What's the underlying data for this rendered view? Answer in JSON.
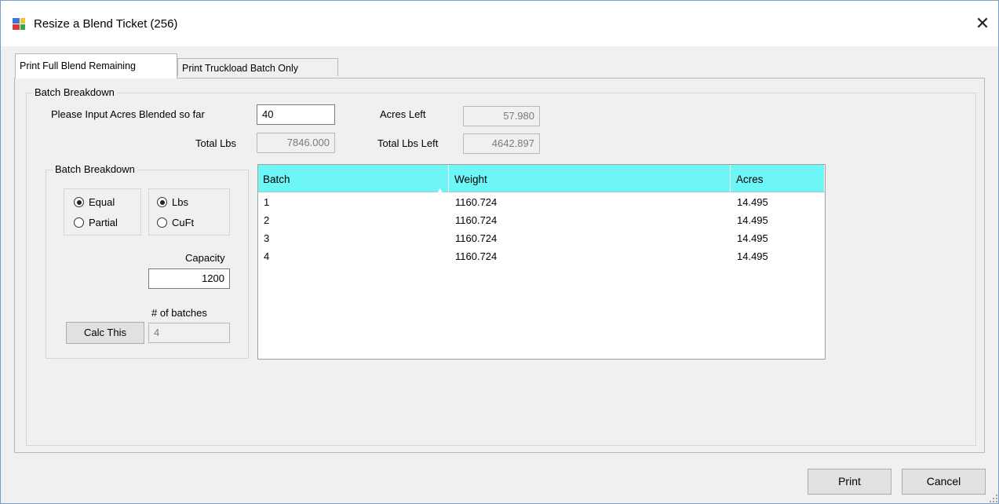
{
  "window": {
    "title": "Resize a Blend Ticket (256)",
    "close_glyph": "✕",
    "icon": "app-window-icon"
  },
  "tabs": [
    {
      "label": "Print Full Blend Remaining",
      "active": true
    },
    {
      "label": "Print Truckload Batch Only",
      "active": false
    }
  ],
  "batch_breakdown_group": {
    "label": "Batch Breakdown",
    "acres_blended_label": "Please Input Acres Blended so far",
    "acres_blended_value": "40",
    "total_lbs_label": "Total Lbs",
    "total_lbs_value": "7846.000",
    "acres_left_label": "Acres Left",
    "acres_left_value": "57.980",
    "total_lbs_left_label": "Total Lbs Left",
    "total_lbs_left_value": "4642.897"
  },
  "inner_group": {
    "label": "Batch Breakdown",
    "mode_options": [
      {
        "label": "Equal",
        "checked": true
      },
      {
        "label": "Partial",
        "checked": false
      }
    ],
    "unit_options": [
      {
        "label": "Lbs",
        "checked": true
      },
      {
        "label": "CuFt",
        "checked": false
      }
    ],
    "capacity_label": "Capacity",
    "capacity_value": "1200",
    "batches_label": "# of batches",
    "batches_value": "4",
    "calc_button": "Calc This"
  },
  "grid": {
    "header_color": "#6ef6f6",
    "columns": [
      "Batch",
      "Weight",
      "Acres"
    ],
    "rows": [
      [
        "1",
        "1160.724",
        "14.495"
      ],
      [
        "2",
        "1160.724",
        "14.495"
      ],
      [
        "3",
        "1160.724",
        "14.495"
      ],
      [
        "4",
        "1160.724",
        "14.495"
      ]
    ]
  },
  "footer": {
    "print_button": "Print",
    "cancel_button": "Cancel"
  }
}
